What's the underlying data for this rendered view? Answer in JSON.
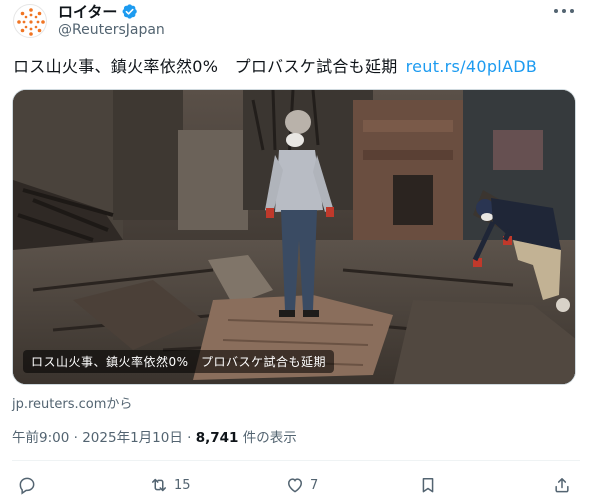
{
  "author": {
    "name": "ロイター",
    "handle": "@ReutersJapan",
    "verified": true,
    "accent_color": "#1d9bf0",
    "logo_color": "#f07524"
  },
  "tweet": {
    "text": "ロス山火事、鎮火率依然0%　プロバスケ試合も延期",
    "link_text": "reut.rs/40plADB"
  },
  "media": {
    "caption": "ロス山火事、鎮火率依然0%　プロバスケ試合も延期",
    "source_label": "jp.reuters.comから"
  },
  "meta": {
    "time": "午前9:00",
    "separator": "·",
    "date": "2025年1月10日",
    "views_count": "8,741",
    "views_label": "件の表示"
  },
  "actions": {
    "reply_icon": "reply-icon",
    "retweet_icon": "retweet-icon",
    "retweet_count": "15",
    "like_icon": "heart-icon",
    "like_count": "7",
    "bookmark_icon": "bookmark-icon",
    "share_icon": "share-icon"
  }
}
